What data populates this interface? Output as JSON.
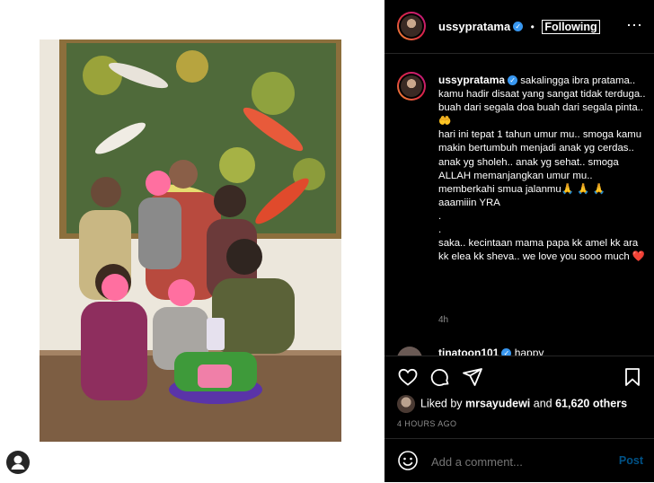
{
  "header": {
    "username": "ussypratama",
    "separator": "•",
    "follow_label": "Following",
    "more": "⋯"
  },
  "caption": {
    "username": "ussypratama",
    "lines": [
      "sakalingga ibra pratama.. kamu hadir disaat yang sangat tidak terduga.. buah dari segala doa buah dari segala pinta.. 🤲",
      "hari ini tepat 1 tahun umur mu.. smoga kamu makin bertumbuh menjadi anak yg cerdas.. anak yg sholeh.. anak yg sehat.. smoga ALLAH memanjangkan umur mu.. memberkahi smua jalanmu🙏 🙏 🙏",
      "aaamiiin YRA",
      ".",
      ".",
      "saka.. kecintaan mama papa kk amel kk ara kk elea kk sheva.. we love you sooo much ❤️"
    ],
    "time": "4h"
  },
  "next_comment": {
    "username": "tinatoon101",
    "text": "happy"
  },
  "likes": {
    "prefix": "Liked by ",
    "user": "mrsayudewi",
    "middle": " and ",
    "count": "61,620 others"
  },
  "posted_time": "4 HOURS AGO",
  "comment": {
    "placeholder": "Add a comment...",
    "post_label": "Post"
  },
  "colors": {
    "verified": "#3897f0",
    "like_heart": "#ed4956",
    "post_link": "#0095f6"
  }
}
